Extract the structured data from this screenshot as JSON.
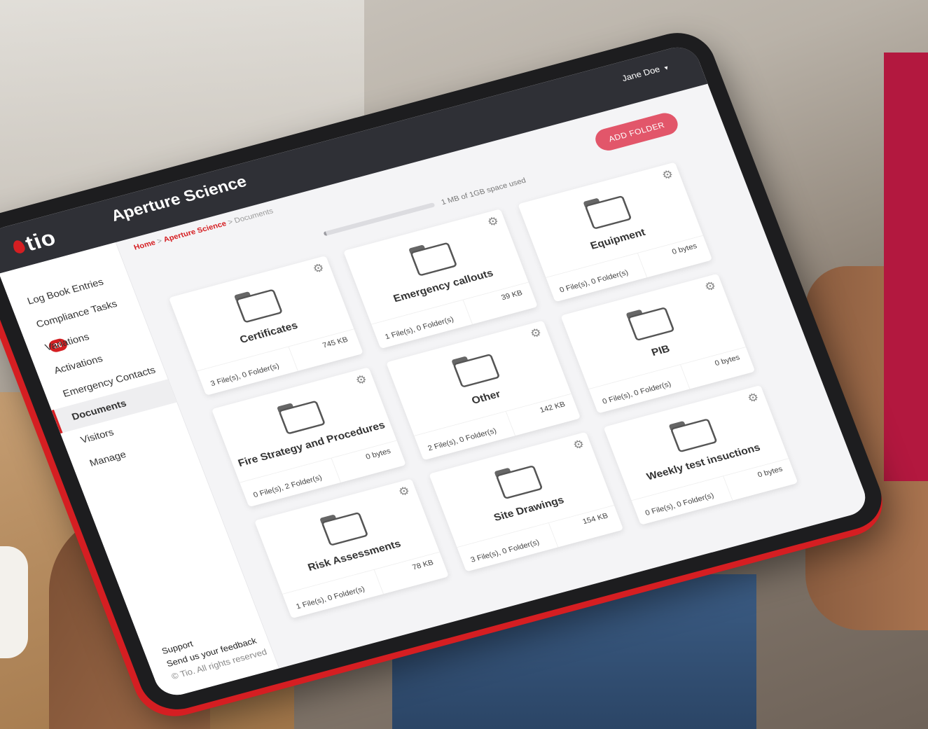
{
  "app": {
    "logo": "tio",
    "title": "Aperture Science",
    "user": "Jane Doe"
  },
  "breadcrumb": {
    "home": "Home",
    "sep1": ">",
    "site": "Aperture Science",
    "sep2": ">",
    "current": "Documents"
  },
  "nav": {
    "items": [
      {
        "label": "Log Book Entries"
      },
      {
        "label": "Compliance Tasks",
        "badge": "20"
      },
      {
        "label": "Variations"
      },
      {
        "label": "Activations"
      },
      {
        "label": "Emergency Contacts"
      },
      {
        "label": "Documents",
        "active": true
      },
      {
        "label": "Visitors"
      },
      {
        "label": "Manage"
      }
    ]
  },
  "footer": {
    "support": "Support",
    "feedback": "Send us your feedback",
    "copyright": "© Tio. All rights reserved"
  },
  "toolbar": {
    "add_folder": "ADD FOLDER"
  },
  "storage": {
    "text": "1 MB of 1GB space used",
    "used_fraction": 0.001
  },
  "folders": [
    {
      "name": "Certificates",
      "files": "3 File(s), 0 Folder(s)",
      "size": "745 KB"
    },
    {
      "name": "Emergency callouts",
      "files": "1 File(s), 0 Folder(s)",
      "size": "39 KB"
    },
    {
      "name": "Equipment",
      "files": "0 File(s), 0 Folder(s)",
      "size": "0 bytes"
    },
    {
      "name": "Fire Strategy and Procedures",
      "files": "0 File(s), 2 Folder(s)",
      "size": "0 bytes"
    },
    {
      "name": "Other",
      "files": "2 File(s), 0 Folder(s)",
      "size": "142 KB"
    },
    {
      "name": "PIB",
      "files": "0 File(s), 0 Folder(s)",
      "size": "0 bytes"
    },
    {
      "name": "Risk Assessments",
      "files": "1 File(s), 0 Folder(s)",
      "size": "78 KB"
    },
    {
      "name": "Site Drawings",
      "files": "3 File(s), 0 Folder(s)",
      "size": "154 KB"
    },
    {
      "name": "Weekly test insuctions",
      "files": "0 File(s), 0 Folder(s)",
      "size": "0 bytes"
    }
  ],
  "colors": {
    "accent": "#d51e22",
    "topbar": "#2f3036",
    "button": "#e2566a",
    "brand_panel": "#b3183f"
  },
  "icons": {
    "gear": "gear-icon",
    "folder": "folder-icon",
    "caret": "chevron-down-icon"
  }
}
